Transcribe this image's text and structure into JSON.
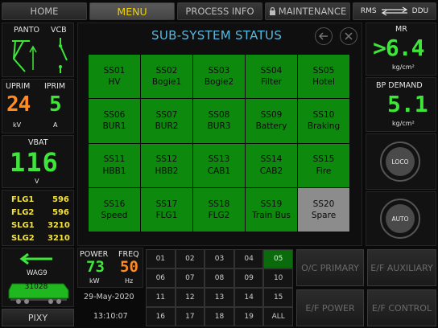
{
  "nav": {
    "home": "HOME",
    "menu": "MENU",
    "process_info": "PROCESS INFO",
    "maintenance": "MAINTENANCE",
    "rms": "RMS",
    "ddu": "DDU"
  },
  "left": {
    "panto": "PANTO",
    "vcb": "VCB",
    "uprim_label": "UPRIM",
    "uprim_value": "24",
    "uprim_unit": "kV",
    "iprim_label": "IPRIM",
    "iprim_value": "5",
    "iprim_unit": "A",
    "vbat_label": "VBAT",
    "vbat_value": "116",
    "vbat_unit": "V",
    "flags": [
      {
        "name": "FLG1",
        "value": "596"
      },
      {
        "name": "FLG2",
        "value": "596"
      },
      {
        "name": "SLG1",
        "value": "3210"
      },
      {
        "name": "SLG2",
        "value": "3210"
      }
    ],
    "loco_number": "31028",
    "loco_class": "WAG9",
    "pixy": "PIXY"
  },
  "main": {
    "title": "SUB-SYSTEM STATUS",
    "subsystems": [
      {
        "code": "SS01",
        "name": "HV",
        "status": "ok"
      },
      {
        "code": "SS02",
        "name": "Bogie1",
        "status": "ok"
      },
      {
        "code": "SS03",
        "name": "Bogie2",
        "status": "ok"
      },
      {
        "code": "SS04",
        "name": "Filter",
        "status": "ok"
      },
      {
        "code": "SS05",
        "name": "Hotel",
        "status": "ok"
      },
      {
        "code": "SS06",
        "name": "BUR1",
        "status": "ok"
      },
      {
        "code": "SS07",
        "name": "BUR2",
        "status": "ok"
      },
      {
        "code": "SS08",
        "name": "BUR3",
        "status": "ok"
      },
      {
        "code": "SS09",
        "name": "Battery",
        "status": "ok"
      },
      {
        "code": "SS10",
        "name": "Braking",
        "status": "ok"
      },
      {
        "code": "SS11",
        "name": "HBB1",
        "status": "ok"
      },
      {
        "code": "SS12",
        "name": "HBB2",
        "status": "ok"
      },
      {
        "code": "SS13",
        "name": "CAB1",
        "status": "ok"
      },
      {
        "code": "SS14",
        "name": "CAB2",
        "status": "ok"
      },
      {
        "code": "SS15",
        "name": "Fire",
        "status": "ok"
      },
      {
        "code": "SS16",
        "name": "Speed",
        "status": "ok"
      },
      {
        "code": "SS17",
        "name": "FLG1",
        "status": "ok"
      },
      {
        "code": "SS18",
        "name": "FLG2",
        "status": "ok"
      },
      {
        "code": "SS19",
        "name": "Train Bus",
        "status": "ok"
      },
      {
        "code": "SS20",
        "name": "Spare",
        "status": "spare"
      }
    ]
  },
  "bottom": {
    "power_label": "POWER",
    "power_value": "73",
    "power_unit": "kW",
    "freq_label": "FREQ",
    "freq_value": "50",
    "freq_unit": "Hz",
    "date": "29-May-2020",
    "time": "13:10:07",
    "numbers": [
      "01",
      "02",
      "03",
      "04",
      "05",
      "06",
      "07",
      "08",
      "09",
      "10",
      "11",
      "12",
      "13",
      "14",
      "15",
      "16",
      "17",
      "18",
      "19",
      "ALL"
    ],
    "oc_primary": "O/C PRIMARY",
    "ef_auxiliary": "E/F AUXILIARY",
    "ef_power": "E/F POWER",
    "ef_control": "E/F CONTROL"
  },
  "right": {
    "mr_label": "MR",
    "mr_value": ">6.4",
    "mr_unit": "kg/cm²",
    "bp_label": "BP DEMAND",
    "bp_value": "5.1",
    "bp_unit": "kg/cm²",
    "loco_btn": "LOCO",
    "auto_btn": "AUTO"
  },
  "colors": {
    "seg_green": "#3ee63a",
    "seg_orange": "#ff8a22",
    "subsystem_ok": "#0d8a0d",
    "subsystem_spare": "#8c8c8c",
    "title": "#5ab8e0",
    "flag_text": "#f4e33a"
  }
}
